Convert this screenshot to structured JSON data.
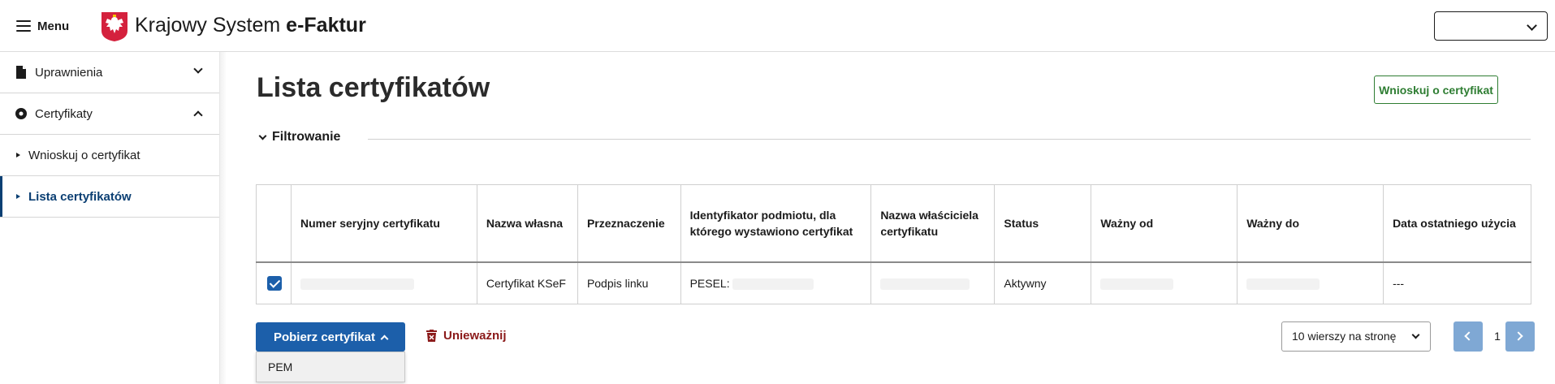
{
  "header": {
    "menu_label": "Menu",
    "brand_regular": "Krajowy System ",
    "brand_bold": "e-Faktur"
  },
  "sidebar": {
    "items": [
      {
        "label": "Uprawnienia",
        "icon": "document-icon"
      },
      {
        "label": "Certyfikaty",
        "icon": "disc-icon"
      }
    ],
    "sub_items": [
      {
        "label": "Wnioskuj o certyfikat"
      },
      {
        "label": "Lista certyfikatów"
      }
    ]
  },
  "main": {
    "title": "Lista certyfikatów",
    "request_button": "Wnioskuj o certyfikat",
    "filter_label": "Filtrowanie"
  },
  "table": {
    "headers": [
      "Numer seryjny certyfikatu",
      "Nazwa własna",
      "Przeznaczenie",
      "Identyfikator podmiotu, dla którego wystawiono certyfikat",
      "Nazwa właściciela certyfikatu",
      "Status",
      "Ważny od",
      "Ważny do",
      "Data ostatniego użycia"
    ],
    "rows": [
      {
        "checked": true,
        "serial": "",
        "name": "Certyfikat KSeF",
        "purpose": "Podpis linku",
        "identifier": "PESEL:",
        "owner": "",
        "status": "Aktywny",
        "valid_from": "",
        "valid_to": "",
        "last_used": "---"
      }
    ]
  },
  "actions": {
    "download_label": "Pobierz certyfikat",
    "download_options": [
      "PEM"
    ],
    "revoke_label": "Unieważnij"
  },
  "pagination": {
    "rows_per_page": "10 wierszy na stronę",
    "current_page": "1"
  },
  "colors": {
    "primary": "#1c5faa",
    "success": "#2e7d32",
    "danger": "#8b1a1a",
    "active_nav": "#0b3f73"
  }
}
